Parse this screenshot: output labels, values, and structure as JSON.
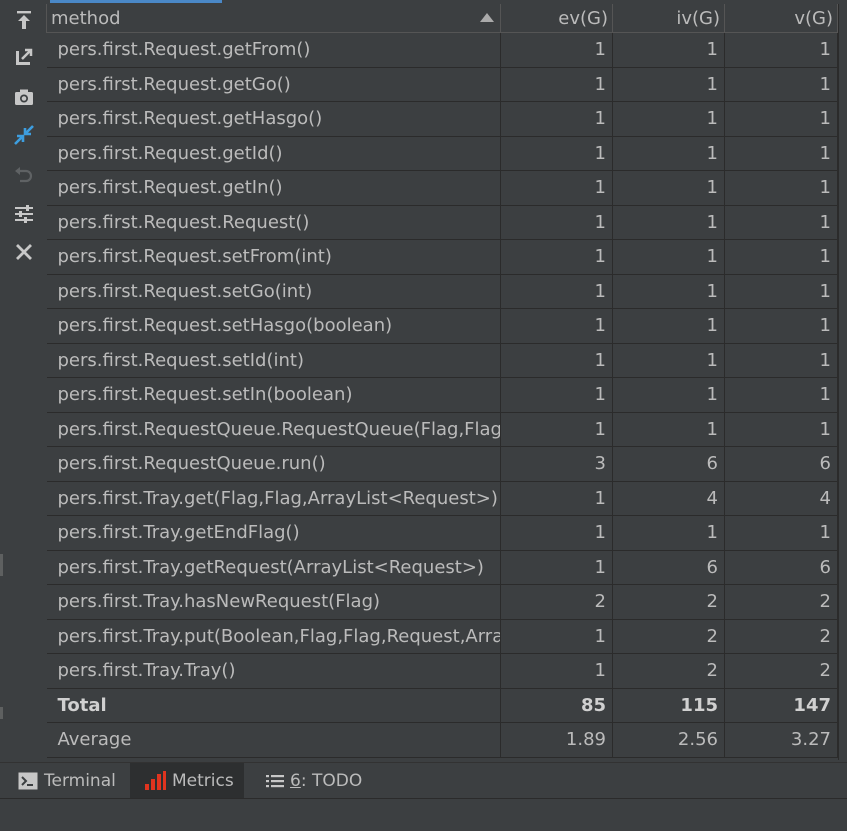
{
  "columns": {
    "method": "method",
    "ev": "ev(G)",
    "iv": "iv(G)",
    "v": "v(G)"
  },
  "rows": [
    {
      "method": "pers.first.Request.getFrom()",
      "ev": "1",
      "iv": "1",
      "v": "1"
    },
    {
      "method": "pers.first.Request.getGo()",
      "ev": "1",
      "iv": "1",
      "v": "1"
    },
    {
      "method": "pers.first.Request.getHasgo()",
      "ev": "1",
      "iv": "1",
      "v": "1"
    },
    {
      "method": "pers.first.Request.getId()",
      "ev": "1",
      "iv": "1",
      "v": "1"
    },
    {
      "method": "pers.first.Request.getIn()",
      "ev": "1",
      "iv": "1",
      "v": "1"
    },
    {
      "method": "pers.first.Request.Request()",
      "ev": "1",
      "iv": "1",
      "v": "1"
    },
    {
      "method": "pers.first.Request.setFrom(int)",
      "ev": "1",
      "iv": "1",
      "v": "1"
    },
    {
      "method": "pers.first.Request.setGo(int)",
      "ev": "1",
      "iv": "1",
      "v": "1"
    },
    {
      "method": "pers.first.Request.setHasgo(boolean)",
      "ev": "1",
      "iv": "1",
      "v": "1"
    },
    {
      "method": "pers.first.Request.setId(int)",
      "ev": "1",
      "iv": "1",
      "v": "1"
    },
    {
      "method": "pers.first.Request.setIn(boolean)",
      "ev": "1",
      "iv": "1",
      "v": "1"
    },
    {
      "method": "pers.first.RequestQueue.RequestQueue(Flag,Flag,Ar",
      "ev": "1",
      "iv": "1",
      "v": "1"
    },
    {
      "method": "pers.first.RequestQueue.run()",
      "ev": "3",
      "iv": "6",
      "v": "6"
    },
    {
      "method": "pers.first.Tray.get(Flag,Flag,ArrayList<Request>)",
      "ev": "1",
      "iv": "4",
      "v": "4"
    },
    {
      "method": "pers.first.Tray.getEndFlag()",
      "ev": "1",
      "iv": "1",
      "v": "1"
    },
    {
      "method": "pers.first.Tray.getRequest(ArrayList<Request>)",
      "ev": "1",
      "iv": "6",
      "v": "6"
    },
    {
      "method": "pers.first.Tray.hasNewRequest(Flag)",
      "ev": "2",
      "iv": "2",
      "v": "2"
    },
    {
      "method": "pers.first.Tray.put(Boolean,Flag,Flag,Request,ArrayLi",
      "ev": "1",
      "iv": "2",
      "v": "2"
    },
    {
      "method": "pers.first.Tray.Tray()",
      "ev": "1",
      "iv": "2",
      "v": "2"
    }
  ],
  "total": {
    "label": "Total",
    "ev": "85",
    "iv": "115",
    "v": "147"
  },
  "average": {
    "label": "Average",
    "ev": "1.89",
    "iv": "2.56",
    "v": "3.27"
  },
  "toolbar": {
    "icons": [
      "export-top-icon",
      "expand-icon",
      "camera-icon",
      "collapse-icon",
      "undo-icon",
      "settings-sliders-icon",
      "close-icon"
    ]
  },
  "bottom_tabs": {
    "terminal": "Terminal",
    "metrics": "Metrics",
    "todo_num": "6",
    "todo_rest": ": TODO"
  },
  "colors": {
    "background": "#3c3f41",
    "grid": "#2b2b2b",
    "text": "#bbbbbb",
    "accent_blue": "#4a88c7",
    "metrics_red": "#e0341f"
  }
}
